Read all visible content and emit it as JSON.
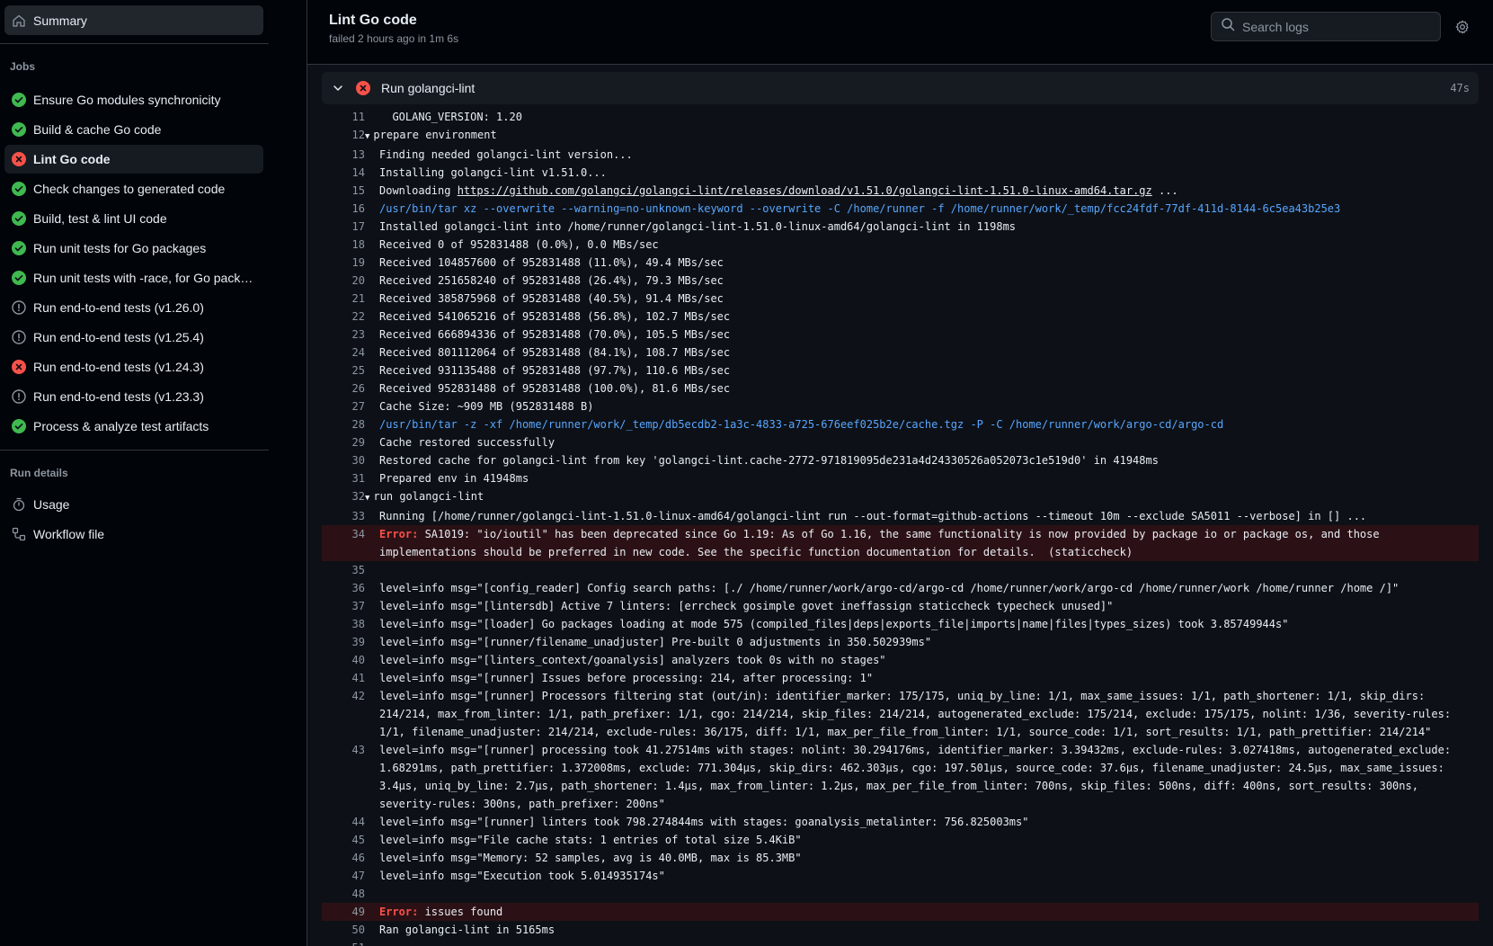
{
  "sidebar": {
    "summary_label": "Summary",
    "jobs_heading": "Jobs",
    "jobs": [
      {
        "label": "Ensure Go modules synchronicity",
        "status": "success"
      },
      {
        "label": "Build & cache Go code",
        "status": "success"
      },
      {
        "label": "Lint Go code",
        "status": "failure",
        "active": true
      },
      {
        "label": "Check changes to generated code",
        "status": "success"
      },
      {
        "label": "Build, test & lint UI code",
        "status": "success"
      },
      {
        "label": "Run unit tests for Go packages",
        "status": "success"
      },
      {
        "label": "Run unit tests with -race, for Go pack…",
        "status": "success"
      },
      {
        "label": "Run end-to-end tests (v1.26.0)",
        "status": "cancelled"
      },
      {
        "label": "Run end-to-end tests (v1.25.4)",
        "status": "cancelled"
      },
      {
        "label": "Run end-to-end tests (v1.24.3)",
        "status": "failure"
      },
      {
        "label": "Run end-to-end tests (v1.23.3)",
        "status": "cancelled"
      },
      {
        "label": "Process & analyze test artifacts",
        "status": "success"
      }
    ],
    "run_details_heading": "Run details",
    "usage_label": "Usage",
    "workflow_label": "Workflow file"
  },
  "header": {
    "title": "Lint Go code",
    "meta": "failed 2 hours ago in 1m 6s",
    "search_placeholder": "Search logs"
  },
  "step": {
    "name": "Run golangci-lint",
    "duration": "47s"
  },
  "log": [
    {
      "n": "11",
      "text": "  GOLANG_VERSION: 1.20"
    },
    {
      "n": "12",
      "text": "prepare environment",
      "group": true
    },
    {
      "n": "13",
      "text": "Finding needed golangci-lint version..."
    },
    {
      "n": "14",
      "text": "Installing golangci-lint v1.51.0..."
    },
    {
      "n": "15",
      "pre": "Downloading ",
      "link": "https://github.com/golangci/golangci-lint/releases/download/v1.51.0/golangci-lint-1.51.0-linux-amd64.tar.gz",
      "post": " ..."
    },
    {
      "n": "16",
      "text": "/usr/bin/tar xz --overwrite --warning=no-unknown-keyword --overwrite -C /home/runner -f /home/runner/work/_temp/fcc24fdf-77df-411d-8144-6c5ea43b25e3",
      "cmd": true
    },
    {
      "n": "17",
      "text": "Installed golangci-lint into /home/runner/golangci-lint-1.51.0-linux-amd64/golangci-lint in 1198ms"
    },
    {
      "n": "18",
      "text": "Received 0 of 952831488 (0.0%), 0.0 MBs/sec"
    },
    {
      "n": "19",
      "text": "Received 104857600 of 952831488 (11.0%), 49.4 MBs/sec"
    },
    {
      "n": "20",
      "text": "Received 251658240 of 952831488 (26.4%), 79.3 MBs/sec"
    },
    {
      "n": "21",
      "text": "Received 385875968 of 952831488 (40.5%), 91.4 MBs/sec"
    },
    {
      "n": "22",
      "text": "Received 541065216 of 952831488 (56.8%), 102.7 MBs/sec"
    },
    {
      "n": "23",
      "text": "Received 666894336 of 952831488 (70.0%), 105.5 MBs/sec"
    },
    {
      "n": "24",
      "text": "Received 801112064 of 952831488 (84.1%), 108.7 MBs/sec"
    },
    {
      "n": "25",
      "text": "Received 931135488 of 952831488 (97.7%), 110.6 MBs/sec"
    },
    {
      "n": "26",
      "text": "Received 952831488 of 952831488 (100.0%), 81.6 MBs/sec"
    },
    {
      "n": "27",
      "text": "Cache Size: ~909 MB (952831488 B)"
    },
    {
      "n": "28",
      "text": "/usr/bin/tar -z -xf /home/runner/work/_temp/db5ecdb2-1a3c-4833-a725-676eef025b2e/cache.tgz -P -C /home/runner/work/argo-cd/argo-cd",
      "cmd": true
    },
    {
      "n": "29",
      "text": "Cache restored successfully"
    },
    {
      "n": "30",
      "text": "Restored cache for golangci-lint from key 'golangci-lint.cache-2772-971819095de231a4d24330526a052073c1e519d0' in 41948ms"
    },
    {
      "n": "31",
      "text": "Prepared env in 41948ms"
    },
    {
      "n": "32",
      "text": "run golangci-lint",
      "group": true
    },
    {
      "n": "33",
      "text": "Running [/home/runner/golangci-lint-1.51.0-linux-amd64/golangci-lint run --out-format=github-actions --timeout 10m --exclude SA5011 --verbose] in [] ..."
    },
    {
      "n": "34",
      "err": "Error:",
      "text": " SA1019: \"io/ioutil\" has been deprecated since Go 1.19: As of Go 1.16, the same functionality is now provided by package io or package os, and those implementations should be preferred in new code. See the specific function documentation for details.  (staticcheck)",
      "error": true
    },
    {
      "n": "35",
      "text": ""
    },
    {
      "n": "36",
      "text": "level=info msg=\"[config_reader] Config search paths: [./ /home/runner/work/argo-cd/argo-cd /home/runner/work/argo-cd /home/runner/work /home/runner /home /]\""
    },
    {
      "n": "37",
      "text": "level=info msg=\"[lintersdb] Active 7 linters: [errcheck gosimple govet ineffassign staticcheck typecheck unused]\""
    },
    {
      "n": "38",
      "text": "level=info msg=\"[loader] Go packages loading at mode 575 (compiled_files|deps|exports_file|imports|name|files|types_sizes) took 3.85749944s\""
    },
    {
      "n": "39",
      "text": "level=info msg=\"[runner/filename_unadjuster] Pre-built 0 adjustments in 350.502939ms\""
    },
    {
      "n": "40",
      "text": "level=info msg=\"[linters_context/goanalysis] analyzers took 0s with no stages\""
    },
    {
      "n": "41",
      "text": "level=info msg=\"[runner] Issues before processing: 214, after processing: 1\""
    },
    {
      "n": "42",
      "text": "level=info msg=\"[runner] Processors filtering stat (out/in): identifier_marker: 175/175, uniq_by_line: 1/1, max_same_issues: 1/1, path_shortener: 1/1, skip_dirs: 214/214, max_from_linter: 1/1, path_prefixer: 1/1, cgo: 214/214, skip_files: 214/214, autogenerated_exclude: 175/214, exclude: 175/175, nolint: 1/36, severity-rules: 1/1, filename_unadjuster: 214/214, exclude-rules: 36/175, diff: 1/1, max_per_file_from_linter: 1/1, source_code: 1/1, sort_results: 1/1, path_prettifier: 214/214\""
    },
    {
      "n": "43",
      "text": "level=info msg=\"[runner] processing took 41.27514ms with stages: nolint: 30.294176ms, identifier_marker: 3.39432ms, exclude-rules: 3.027418ms, autogenerated_exclude: 1.68291ms, path_prettifier: 1.372008ms, exclude: 771.304µs, skip_dirs: 462.303µs, cgo: 197.501µs, source_code: 37.6µs, filename_unadjuster: 24.5µs, max_same_issues: 3.4µs, uniq_by_line: 2.7µs, path_shortener: 1.4µs, max_from_linter: 1.2µs, max_per_file_from_linter: 700ns, skip_files: 500ns, diff: 400ns, sort_results: 300ns, severity-rules: 300ns, path_prefixer: 200ns\""
    },
    {
      "n": "44",
      "text": "level=info msg=\"[runner] linters took 798.274844ms with stages: goanalysis_metalinter: 756.825003ms\""
    },
    {
      "n": "45",
      "text": "level=info msg=\"File cache stats: 1 entries of total size 5.4KiB\""
    },
    {
      "n": "46",
      "text": "level=info msg=\"Memory: 52 samples, avg is 40.0MB, max is 85.3MB\""
    },
    {
      "n": "47",
      "text": "level=info msg=\"Execution took 5.014935174s\""
    },
    {
      "n": "48",
      "text": ""
    },
    {
      "n": "49",
      "err": "Error:",
      "text": " issues found",
      "error": true
    },
    {
      "n": "50",
      "text": "Ran golangci-lint in 5165ms"
    },
    {
      "n": "51",
      "text": ""
    }
  ],
  "colors": {
    "success": "#3fb950",
    "failure": "#f85149",
    "cancelled": "#8d96a0",
    "accent": "#1f6feb"
  }
}
